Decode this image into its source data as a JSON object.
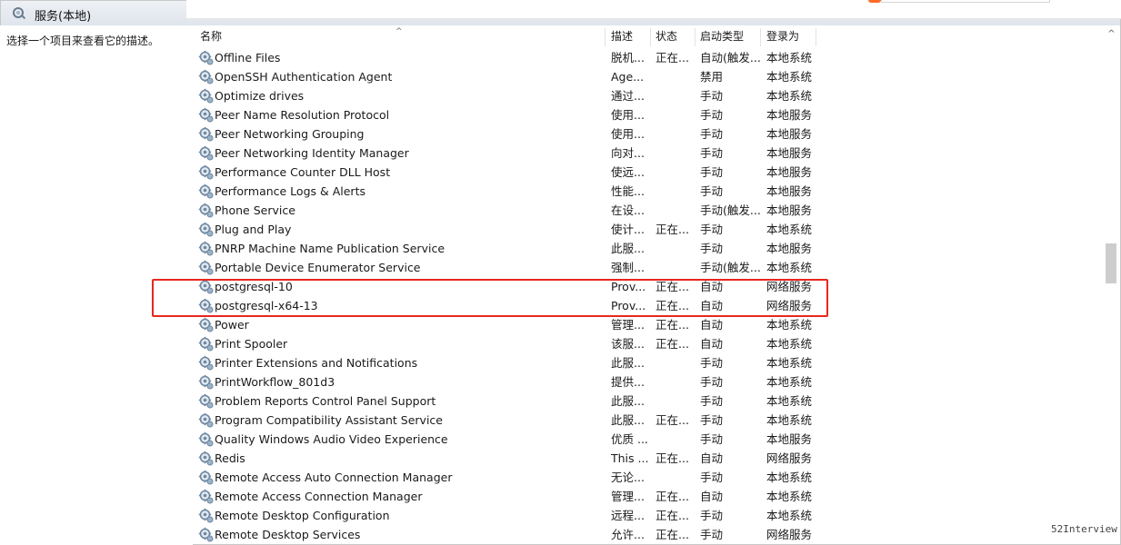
{
  "window": {
    "title": "服务(本地)"
  },
  "left_pane": {
    "description": "选择一个项目来查看它的描述。"
  },
  "columns": {
    "name": "名称",
    "description": "描述",
    "status": "状态",
    "startup_type": "启动类型",
    "logon_as": "登录为"
  },
  "services": [
    {
      "name": "Offline Files",
      "description": "脱机...",
      "status": "正在...",
      "startup_type": "自动(触发...",
      "logon_as": "本地系统"
    },
    {
      "name": "OpenSSH Authentication Agent",
      "description": "Age...",
      "status": "",
      "startup_type": "禁用",
      "logon_as": "本地系统"
    },
    {
      "name": "Optimize drives",
      "description": "通过...",
      "status": "",
      "startup_type": "手动",
      "logon_as": "本地系统"
    },
    {
      "name": "Peer Name Resolution Protocol",
      "description": "使用...",
      "status": "",
      "startup_type": "手动",
      "logon_as": "本地服务"
    },
    {
      "name": "Peer Networking Grouping",
      "description": "使用...",
      "status": "",
      "startup_type": "手动",
      "logon_as": "本地服务"
    },
    {
      "name": "Peer Networking Identity Manager",
      "description": "向对...",
      "status": "",
      "startup_type": "手动",
      "logon_as": "本地服务"
    },
    {
      "name": "Performance Counter DLL Host",
      "description": "使远...",
      "status": "",
      "startup_type": "手动",
      "logon_as": "本地服务"
    },
    {
      "name": "Performance Logs & Alerts",
      "description": "性能...",
      "status": "",
      "startup_type": "手动",
      "logon_as": "本地服务"
    },
    {
      "name": "Phone Service",
      "description": "在设...",
      "status": "",
      "startup_type": "手动(触发...",
      "logon_as": "本地服务"
    },
    {
      "name": "Plug and Play",
      "description": "使计...",
      "status": "正在...",
      "startup_type": "手动",
      "logon_as": "本地系统"
    },
    {
      "name": "PNRP Machine Name Publication Service",
      "description": "此服...",
      "status": "",
      "startup_type": "手动",
      "logon_as": "本地服务"
    },
    {
      "name": "Portable Device Enumerator Service",
      "description": "强制...",
      "status": "",
      "startup_type": "手动(触发...",
      "logon_as": "本地系统"
    },
    {
      "name": "postgresql-10",
      "description": "Prov...",
      "status": "正在...",
      "startup_type": "自动",
      "logon_as": "网络服务"
    },
    {
      "name": "postgresql-x64-13",
      "description": "Prov...",
      "status": "正在...",
      "startup_type": "自动",
      "logon_as": "网络服务"
    },
    {
      "name": "Power",
      "description": "管理...",
      "status": "正在...",
      "startup_type": "自动",
      "logon_as": "本地系统"
    },
    {
      "name": "Print Spooler",
      "description": "该服...",
      "status": "正在...",
      "startup_type": "自动",
      "logon_as": "本地系统"
    },
    {
      "name": "Printer Extensions and Notifications",
      "description": "此服...",
      "status": "",
      "startup_type": "手动",
      "logon_as": "本地系统"
    },
    {
      "name": "PrintWorkflow_801d3",
      "description": "提供...",
      "status": "",
      "startup_type": "手动",
      "logon_as": "本地系统"
    },
    {
      "name": "Problem Reports Control Panel Support",
      "description": "此服...",
      "status": "",
      "startup_type": "手动",
      "logon_as": "本地系统"
    },
    {
      "name": "Program Compatibility Assistant Service",
      "description": "此服...",
      "status": "正在...",
      "startup_type": "手动",
      "logon_as": "本地系统"
    },
    {
      "name": "Quality Windows Audio Video Experience",
      "description": "优质 ...",
      "status": "",
      "startup_type": "手动",
      "logon_as": "本地服务"
    },
    {
      "name": "Redis",
      "description": "This ...",
      "status": "正在...",
      "startup_type": "自动",
      "logon_as": "网络服务"
    },
    {
      "name": "Remote Access Auto Connection Manager",
      "description": "无论...",
      "status": "",
      "startup_type": "手动",
      "logon_as": "本地系统"
    },
    {
      "name": "Remote Access Connection Manager",
      "description": "管理...",
      "status": "正在...",
      "startup_type": "自动",
      "logon_as": "本地系统"
    },
    {
      "name": "Remote Desktop Configuration",
      "description": "远程...",
      "status": "正在...",
      "startup_type": "手动",
      "logon_as": "本地系统"
    },
    {
      "name": "Remote Desktop Services",
      "description": "允许...",
      "status": "正在...",
      "startup_type": "手动",
      "logon_as": "网络服务"
    }
  ],
  "watermark": "52Interview",
  "colors": {
    "highlight": "#e8271f",
    "header_bg": "#ffffff",
    "title_bar": "#dfe5ec"
  },
  "icons": {
    "title": "services-gear-icon",
    "row": "service-gear-icon"
  }
}
